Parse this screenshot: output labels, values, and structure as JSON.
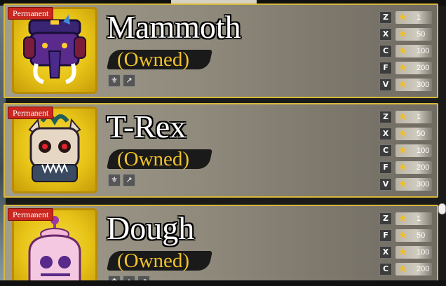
{
  "cards": [
    {
      "badge": "Permanent",
      "name": "Mammoth",
      "status": "(Owned)",
      "small_icons": [
        "slot-icon",
        "slot-icon"
      ],
      "moves": [
        {
          "key": "Z",
          "mastery": "1"
        },
        {
          "key": "X",
          "mastery": "50"
        },
        {
          "key": "C",
          "mastery": "100"
        },
        {
          "key": "F",
          "mastery": "200"
        },
        {
          "key": "V",
          "mastery": "300"
        }
      ]
    },
    {
      "badge": "Permanent",
      "name": "T-Rex",
      "status": "(Owned)",
      "small_icons": [
        "slot-icon",
        "slot-icon"
      ],
      "moves": [
        {
          "key": "Z",
          "mastery": "1"
        },
        {
          "key": "X",
          "mastery": "50"
        },
        {
          "key": "C",
          "mastery": "100"
        },
        {
          "key": "F",
          "mastery": "200"
        },
        {
          "key": "V",
          "mastery": "300"
        }
      ]
    },
    {
      "badge": "Permanent",
      "name": "Dough",
      "status": "(Owned)",
      "small_icons": [
        "slot-icon",
        "slot-icon",
        "slot-icon"
      ],
      "moves": [
        {
          "key": "Z",
          "mastery": "1"
        },
        {
          "key": "F",
          "mastery": "50"
        },
        {
          "key": "X",
          "mastery": "100"
        },
        {
          "key": "C",
          "mastery": "200"
        }
      ]
    }
  ],
  "colors": {
    "gold_border": "#d7b83a",
    "owned_text": "#f0c22a",
    "badge_red": "#c9271f",
    "star": "#f4c01e"
  }
}
